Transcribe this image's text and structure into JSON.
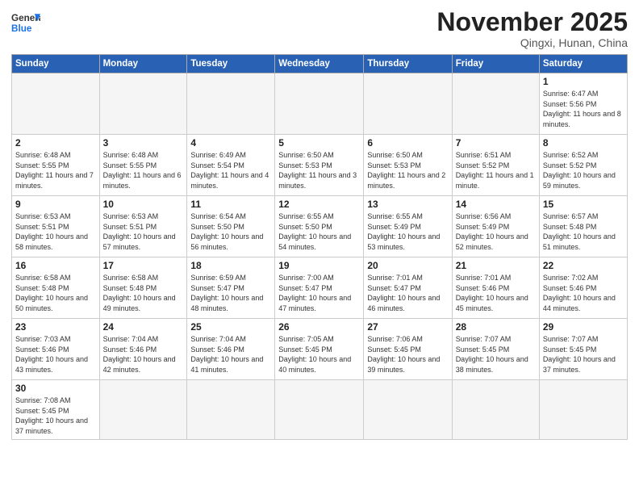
{
  "header": {
    "logo_general": "General",
    "logo_blue": "Blue",
    "month": "November 2025",
    "location": "Qingxi, Hunan, China"
  },
  "weekdays": [
    "Sunday",
    "Monday",
    "Tuesday",
    "Wednesday",
    "Thursday",
    "Friday",
    "Saturday"
  ],
  "weeks": [
    [
      {
        "day": "",
        "info": ""
      },
      {
        "day": "",
        "info": ""
      },
      {
        "day": "",
        "info": ""
      },
      {
        "day": "",
        "info": ""
      },
      {
        "day": "",
        "info": ""
      },
      {
        "day": "",
        "info": ""
      },
      {
        "day": "1",
        "info": "Sunrise: 6:47 AM\nSunset: 5:56 PM\nDaylight: 11 hours and 8 minutes."
      }
    ],
    [
      {
        "day": "2",
        "info": "Sunrise: 6:48 AM\nSunset: 5:55 PM\nDaylight: 11 hours and 7 minutes."
      },
      {
        "day": "3",
        "info": "Sunrise: 6:48 AM\nSunset: 5:55 PM\nDaylight: 11 hours and 6 minutes."
      },
      {
        "day": "4",
        "info": "Sunrise: 6:49 AM\nSunset: 5:54 PM\nDaylight: 11 hours and 4 minutes."
      },
      {
        "day": "5",
        "info": "Sunrise: 6:50 AM\nSunset: 5:53 PM\nDaylight: 11 hours and 3 minutes."
      },
      {
        "day": "6",
        "info": "Sunrise: 6:50 AM\nSunset: 5:53 PM\nDaylight: 11 hours and 2 minutes."
      },
      {
        "day": "7",
        "info": "Sunrise: 6:51 AM\nSunset: 5:52 PM\nDaylight: 11 hours and 1 minute."
      },
      {
        "day": "8",
        "info": "Sunrise: 6:52 AM\nSunset: 5:52 PM\nDaylight: 10 hours and 59 minutes."
      }
    ],
    [
      {
        "day": "9",
        "info": "Sunrise: 6:53 AM\nSunset: 5:51 PM\nDaylight: 10 hours and 58 minutes."
      },
      {
        "day": "10",
        "info": "Sunrise: 6:53 AM\nSunset: 5:51 PM\nDaylight: 10 hours and 57 minutes."
      },
      {
        "day": "11",
        "info": "Sunrise: 6:54 AM\nSunset: 5:50 PM\nDaylight: 10 hours and 56 minutes."
      },
      {
        "day": "12",
        "info": "Sunrise: 6:55 AM\nSunset: 5:50 PM\nDaylight: 10 hours and 54 minutes."
      },
      {
        "day": "13",
        "info": "Sunrise: 6:55 AM\nSunset: 5:49 PM\nDaylight: 10 hours and 53 minutes."
      },
      {
        "day": "14",
        "info": "Sunrise: 6:56 AM\nSunset: 5:49 PM\nDaylight: 10 hours and 52 minutes."
      },
      {
        "day": "15",
        "info": "Sunrise: 6:57 AM\nSunset: 5:48 PM\nDaylight: 10 hours and 51 minutes."
      }
    ],
    [
      {
        "day": "16",
        "info": "Sunrise: 6:58 AM\nSunset: 5:48 PM\nDaylight: 10 hours and 50 minutes."
      },
      {
        "day": "17",
        "info": "Sunrise: 6:58 AM\nSunset: 5:48 PM\nDaylight: 10 hours and 49 minutes."
      },
      {
        "day": "18",
        "info": "Sunrise: 6:59 AM\nSunset: 5:47 PM\nDaylight: 10 hours and 48 minutes."
      },
      {
        "day": "19",
        "info": "Sunrise: 7:00 AM\nSunset: 5:47 PM\nDaylight: 10 hours and 47 minutes."
      },
      {
        "day": "20",
        "info": "Sunrise: 7:01 AM\nSunset: 5:47 PM\nDaylight: 10 hours and 46 minutes."
      },
      {
        "day": "21",
        "info": "Sunrise: 7:01 AM\nSunset: 5:46 PM\nDaylight: 10 hours and 45 minutes."
      },
      {
        "day": "22",
        "info": "Sunrise: 7:02 AM\nSunset: 5:46 PM\nDaylight: 10 hours and 44 minutes."
      }
    ],
    [
      {
        "day": "23",
        "info": "Sunrise: 7:03 AM\nSunset: 5:46 PM\nDaylight: 10 hours and 43 minutes."
      },
      {
        "day": "24",
        "info": "Sunrise: 7:04 AM\nSunset: 5:46 PM\nDaylight: 10 hours and 42 minutes."
      },
      {
        "day": "25",
        "info": "Sunrise: 7:04 AM\nSunset: 5:46 PM\nDaylight: 10 hours and 41 minutes."
      },
      {
        "day": "26",
        "info": "Sunrise: 7:05 AM\nSunset: 5:45 PM\nDaylight: 10 hours and 40 minutes."
      },
      {
        "day": "27",
        "info": "Sunrise: 7:06 AM\nSunset: 5:45 PM\nDaylight: 10 hours and 39 minutes."
      },
      {
        "day": "28",
        "info": "Sunrise: 7:07 AM\nSunset: 5:45 PM\nDaylight: 10 hours and 38 minutes."
      },
      {
        "day": "29",
        "info": "Sunrise: 7:07 AM\nSunset: 5:45 PM\nDaylight: 10 hours and 37 minutes."
      }
    ],
    [
      {
        "day": "30",
        "info": "Sunrise: 7:08 AM\nSunset: 5:45 PM\nDaylight: 10 hours and 37 minutes."
      },
      {
        "day": "",
        "info": ""
      },
      {
        "day": "",
        "info": ""
      },
      {
        "day": "",
        "info": ""
      },
      {
        "day": "",
        "info": ""
      },
      {
        "day": "",
        "info": ""
      },
      {
        "day": "",
        "info": ""
      }
    ]
  ]
}
